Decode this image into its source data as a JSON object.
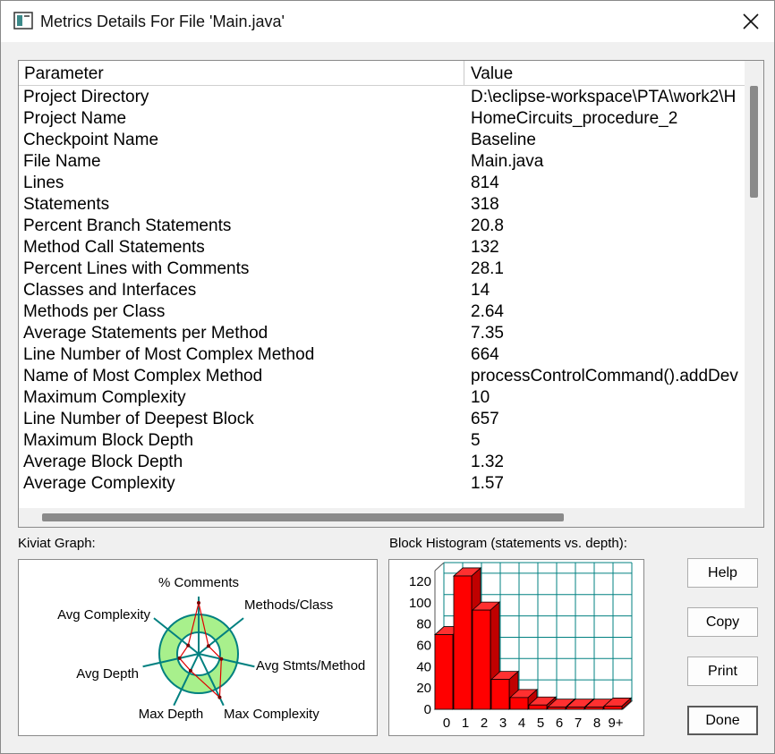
{
  "window": {
    "title": "Metrics Details For File 'Main.java'"
  },
  "table": {
    "columns": [
      "Parameter",
      "Value"
    ],
    "rows": [
      [
        "Project Directory",
        "D:\\eclipse-workspace\\PTA\\work2\\H"
      ],
      [
        "Project Name",
        "HomeCircuits_procedure_2"
      ],
      [
        "Checkpoint Name",
        "Baseline"
      ],
      [
        "File Name",
        "Main.java"
      ],
      [
        "Lines",
        "814"
      ],
      [
        "Statements",
        "318"
      ],
      [
        "Percent Branch Statements",
        "20.8"
      ],
      [
        "Method Call Statements",
        "132"
      ],
      [
        "Percent Lines with Comments",
        "28.1"
      ],
      [
        "Classes and Interfaces",
        "14"
      ],
      [
        "Methods per Class",
        "2.64"
      ],
      [
        "Average Statements per Method",
        "7.35"
      ],
      [
        "Line Number of Most Complex Method",
        "664"
      ],
      [
        "Name of Most Complex Method",
        "processControlCommand().addDev"
      ],
      [
        "Maximum Complexity",
        "10"
      ],
      [
        "Line Number of Deepest Block",
        "657"
      ],
      [
        "Maximum Block Depth",
        "5"
      ],
      [
        "Average Block Depth",
        "1.32"
      ],
      [
        "Average Complexity",
        "1.57"
      ]
    ]
  },
  "kiviat": {
    "label": "Kiviat Graph:",
    "axes": [
      "% Comments",
      "Methods/Class",
      "Avg Stmts/Method",
      "Max Complexity",
      "Max Depth",
      "Avg Depth",
      "Avg Complexity"
    ],
    "colors": {
      "ring": "#a8f08c",
      "outline": "#008080",
      "plot": "#e00000"
    }
  },
  "histogram": {
    "label": "Block Histogram (statements vs. depth):",
    "bar_color": "#ff0000",
    "grid_color": "#008080"
  },
  "chart_data": {
    "type": "bar",
    "title": "Block Histogram (statements vs. depth):",
    "categories": [
      "0",
      "1",
      "2",
      "3",
      "4",
      "5",
      "6",
      "7",
      "8",
      "9+"
    ],
    "values": [
      70,
      125,
      93,
      28,
      11,
      4,
      2,
      2,
      2,
      3
    ],
    "yticks": [
      0,
      20,
      40,
      60,
      80,
      100,
      120
    ],
    "ylim": [
      0,
      130
    ],
    "grid": true
  },
  "buttons": {
    "help": "Help",
    "copy": "Copy",
    "print": "Print",
    "done": "Done"
  }
}
